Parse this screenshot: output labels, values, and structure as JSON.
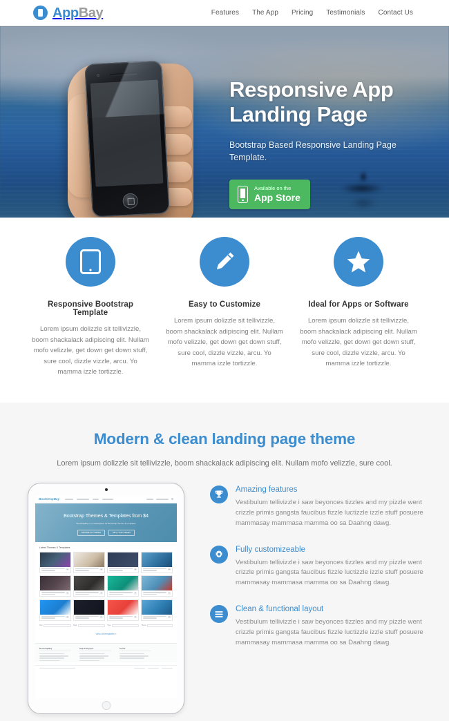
{
  "header": {
    "brand_app": "App",
    "brand_bay": "Bay",
    "nav": [
      {
        "label": "Features"
      },
      {
        "label": "The App"
      },
      {
        "label": "Pricing"
      },
      {
        "label": "Testimonials"
      },
      {
        "label": "Contact Us"
      }
    ]
  },
  "hero": {
    "title_line1": "Responsive App",
    "title_line2": "Landing Page",
    "subtitle": "Bootstrap Based Responsive Landing Page Template.",
    "cta_small": "Available on the",
    "cta_big": "App Store"
  },
  "features": [
    {
      "icon": "tablet-icon",
      "title": "Responsive Bootstrap Template",
      "desc": "Lorem ipsum dolizzle sit tellivizzle, boom shackalack adipiscing elit. Nullam mofo velizzle, get down get down stuff, sure cool, dizzle vizzle, arcu. Yo mamma izzle tortizzle."
    },
    {
      "icon": "pencil-icon",
      "title": "Easy to Customize",
      "desc": "Lorem ipsum dolizzle sit tellivizzle, boom shackalack adipiscing elit. Nullam mofo velizzle, get down get down stuff, sure cool, dizzle vizzle, arcu. Yo mamma izzle tortizzle."
    },
    {
      "icon": "star-icon",
      "title": "Ideal for Apps or Software",
      "desc": "Lorem ipsum dolizzle sit tellivizzle, boom shackalack adipiscing elit. Nullam mofo velizzle, get down get down stuff, sure cool, dizzle vizzle, arcu. Yo mamma izzle tortizzle."
    }
  ],
  "theme": {
    "title": "Modern & clean landing page theme",
    "subtitle": "Lorem ipsum dolizzle sit tellivizzle, boom shackalack adipiscing elit. Nullam mofo velizzle, sure cool.",
    "items": [
      {
        "icon": "trophy-icon",
        "title": "Amazing features",
        "desc": "Vestibulum tellivizzle i saw beyonces tizzles and my pizzle went crizzle primis gangsta faucibus fizzle luctizzle izzle stuff posuere mammasay mammasa mamma oo sa Daahng dawg."
      },
      {
        "icon": "gear-icon",
        "title": "Fully customizeable",
        "desc": "Vestibulum tellivizzle i saw beyonces tizzles and my pizzle went crizzle primis gangsta faucibus fizzle luctizzle izzle stuff posuere mammasay mammasa mamma oo sa Daahng dawg."
      },
      {
        "icon": "list-icon",
        "title": "Clean & functional layout",
        "desc": "Vestibulum tellivizzle i saw beyonces tizzles and my pizzle went crizzle primis gangsta faucibus fizzle luctizzle izzle stuff posuere mammasay mammasa mamma oo sa Daahng dawg."
      }
    ]
  },
  "tablet_screen": {
    "logo": "BootstrapBay",
    "hero_title": "Bootstrap Themes & Templates from $4",
    "hero_sub": "BootstrapBay is a marketplace for Bootstrap themes & templates",
    "hero_btn1": "BROWSE ALL THEMES",
    "hero_btn2": "SELL YOUR THEMES",
    "section_title": "Latest Themes & Templates",
    "view_all": "View all templates »",
    "footer_columns": [
      {
        "title": "BootstrapBay"
      },
      {
        "title": "Help & Support"
      },
      {
        "title": "Social"
      }
    ]
  },
  "colors": {
    "brand_blue": "#3b8dd0",
    "app_store_green": "#4cb860",
    "section_gray": "#f6f6f6"
  }
}
